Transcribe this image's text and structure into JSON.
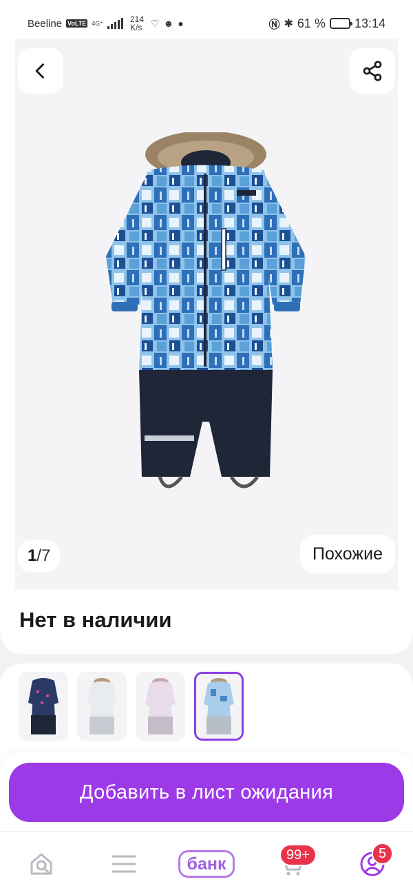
{
  "status_bar": {
    "carrier": "Beeline",
    "volte": "VoLTE",
    "network": "4G⁺",
    "speed_value": "214",
    "speed_unit": "K/s",
    "battery_text": "61 %",
    "battery_level": 0.61,
    "time": "13:14",
    "icons": [
      "heart-rate-icon",
      "smiley-icon",
      "chat-bubble-icon",
      "nfc-icon",
      "bluetooth-icon"
    ]
  },
  "gallery": {
    "current": "1",
    "separator": "/",
    "total": "7",
    "similar_label": "Похожие"
  },
  "product": {
    "stock_status": "Нет в наличии"
  },
  "variants": {
    "items": [
      {
        "name": "navy-print",
        "selected": false
      },
      {
        "name": "white-print",
        "selected": false
      },
      {
        "name": "lilac-print",
        "selected": false
      },
      {
        "name": "blue-city-print",
        "selected": true
      }
    ]
  },
  "cta": {
    "label": "Добавить в лист ожидания"
  },
  "bottom_nav": {
    "bank_label": "банк",
    "cart_badge": "99+",
    "profile_badge": "5"
  },
  "colors": {
    "accent": "#9d3ae8",
    "badge": "#e8334a",
    "suit_blue": "#2f6fb8",
    "suit_navy": "#1e2637"
  }
}
